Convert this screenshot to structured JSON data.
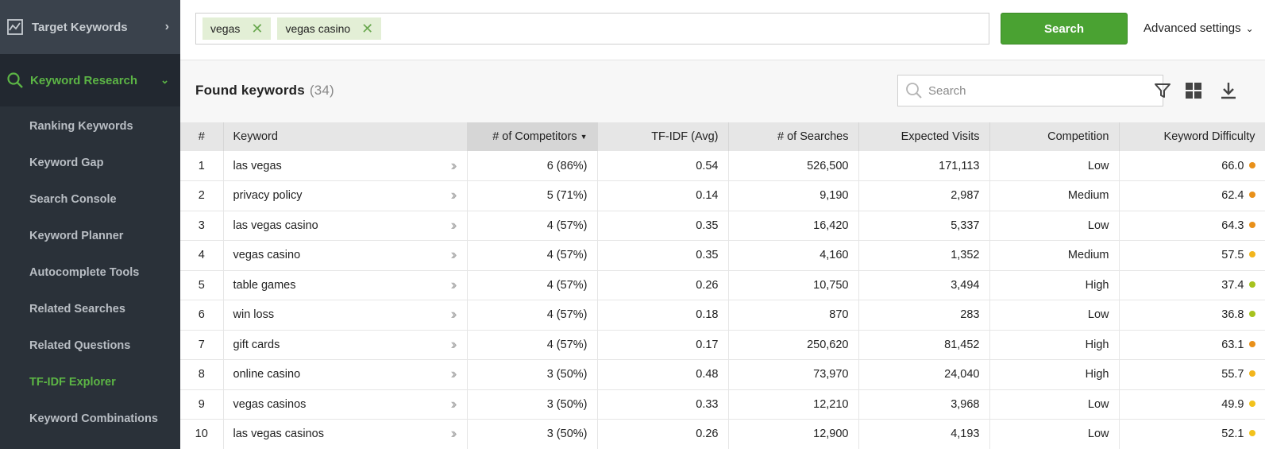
{
  "sidebar": {
    "section": {
      "label": "Target Keywords",
      "icon": "line-chart-icon"
    },
    "active_section": {
      "label": "Keyword Research",
      "icon": "search-icon"
    },
    "items": [
      {
        "label": "Ranking Keywords"
      },
      {
        "label": "Keyword Gap"
      },
      {
        "label": "Search Console"
      },
      {
        "label": "Keyword Planner"
      },
      {
        "label": "Autocomplete Tools"
      },
      {
        "label": "Related Searches"
      },
      {
        "label": "Related Questions"
      },
      {
        "label": "TF-IDF Explorer",
        "current": true
      },
      {
        "label": "Keyword Combinations"
      }
    ]
  },
  "topbar": {
    "tags": [
      "vegas",
      "vegas casino"
    ],
    "search_label": "Search",
    "advanced_label": "Advanced settings"
  },
  "found": {
    "title": "Found keywords",
    "count": "(34)",
    "search_placeholder": "Search"
  },
  "table": {
    "columns": [
      "#",
      "Keyword",
      "# of Competitors",
      "TF-IDF (Avg)",
      "# of Searches",
      "Expected Visits",
      "Competition",
      "Keyword Difficulty"
    ],
    "rows": [
      {
        "n": "1",
        "keyword": "las vegas",
        "competitors": "6 (86%)",
        "tfidf": "0.54",
        "searches": "526,500",
        "visits": "171,113",
        "competition": "Low",
        "difficulty": "66.0",
        "dot": "#e8901a"
      },
      {
        "n": "2",
        "keyword": "privacy policy",
        "competitors": "5 (71%)",
        "tfidf": "0.14",
        "searches": "9,190",
        "visits": "2,987",
        "competition": "Medium",
        "difficulty": "62.4",
        "dot": "#e8901a"
      },
      {
        "n": "3",
        "keyword": "las vegas casino",
        "competitors": "4 (57%)",
        "tfidf": "0.35",
        "searches": "16,420",
        "visits": "5,337",
        "competition": "Low",
        "difficulty": "64.3",
        "dot": "#e8901a"
      },
      {
        "n": "4",
        "keyword": "vegas casino",
        "competitors": "4 (57%)",
        "tfidf": "0.35",
        "searches": "4,160",
        "visits": "1,352",
        "competition": "Medium",
        "difficulty": "57.5",
        "dot": "#f2b51c"
      },
      {
        "n": "5",
        "keyword": "table games",
        "competitors": "4 (57%)",
        "tfidf": "0.26",
        "searches": "10,750",
        "visits": "3,494",
        "competition": "High",
        "difficulty": "37.4",
        "dot": "#a6c21e"
      },
      {
        "n": "6",
        "keyword": "win loss",
        "competitors": "4 (57%)",
        "tfidf": "0.18",
        "searches": "870",
        "visits": "283",
        "competition": "Low",
        "difficulty": "36.8",
        "dot": "#a6c21e"
      },
      {
        "n": "7",
        "keyword": "gift cards",
        "competitors": "4 (57%)",
        "tfidf": "0.17",
        "searches": "250,620",
        "visits": "81,452",
        "competition": "High",
        "difficulty": "63.1",
        "dot": "#e8901a"
      },
      {
        "n": "8",
        "keyword": "online casino",
        "competitors": "3 (50%)",
        "tfidf": "0.48",
        "searches": "73,970",
        "visits": "24,040",
        "competition": "High",
        "difficulty": "55.7",
        "dot": "#f2b51c"
      },
      {
        "n": "9",
        "keyword": "vegas casinos",
        "competitors": "3 (50%)",
        "tfidf": "0.33",
        "searches": "12,210",
        "visits": "3,968",
        "competition": "Low",
        "difficulty": "49.9",
        "dot": "#f2c21c"
      },
      {
        "n": "10",
        "keyword": "las vegas casinos",
        "competitors": "3 (50%)",
        "tfidf": "0.26",
        "searches": "12,900",
        "visits": "4,193",
        "competition": "Low",
        "difficulty": "52.1",
        "dot": "#f2c21c"
      }
    ]
  }
}
